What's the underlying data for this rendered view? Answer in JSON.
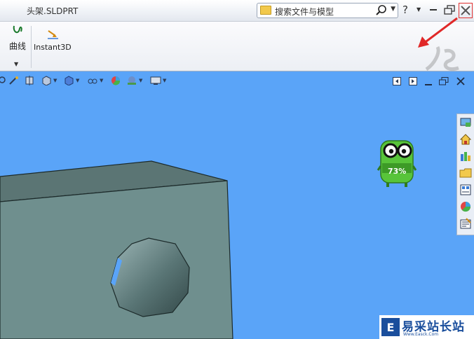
{
  "window": {
    "title": "头架.SLDPRT",
    "search_placeholder": "搜索文件与模型",
    "help_label": "?"
  },
  "ribbon": {
    "curve_label": "曲线",
    "instant3d_label": "Instant3D"
  },
  "mascot": {
    "percent": "73%"
  },
  "watermark": {
    "text": "易采站长站",
    "sub": "Www.Easck.Com"
  },
  "colors": {
    "viewport_bg": "#5aa4f8",
    "part_face": "#6f8f8e",
    "part_top": "#5b7574",
    "annotation_red": "#e02828"
  }
}
